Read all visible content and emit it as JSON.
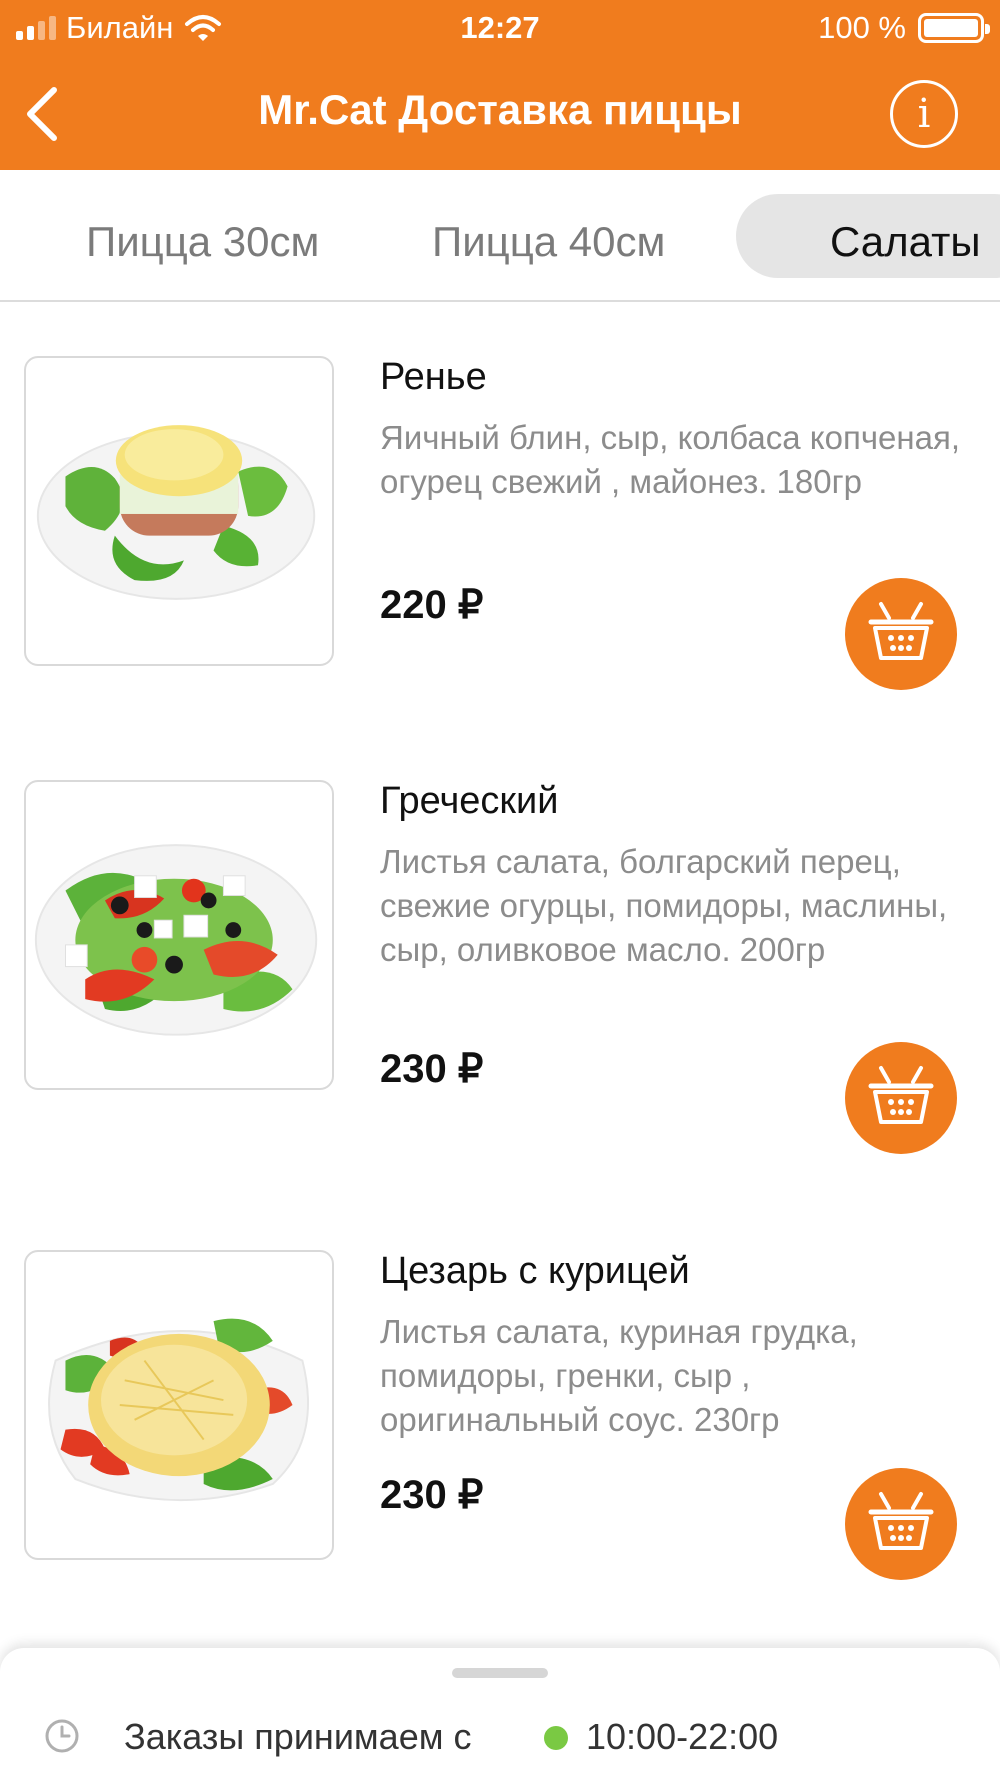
{
  "status_bar": {
    "carrier": "Билайн",
    "time": "12:27",
    "battery": "100 %"
  },
  "header": {
    "title": "Mr.Cat Доставка пиццы",
    "info_label": "i",
    "accent_color": "#f07c1e"
  },
  "tabs": [
    {
      "label": "Пицца 30см",
      "active": false
    },
    {
      "label": "Пицца 40см",
      "active": false
    },
    {
      "label": "Салаты",
      "active": true
    }
  ],
  "products": [
    {
      "name": "Ренье",
      "description": "Яичный блин, сыр, колбаса копченая, огурец свежий , майонез. 180гр",
      "price": "220 ₽",
      "icon": "basket-icon"
    },
    {
      "name": "Греческий",
      "description": "Листья салата, болгарский перец, свежие огурцы, помидоры, маслины, сыр, оливковое масло. 200гр",
      "price": "230 ₽",
      "icon": "basket-icon"
    },
    {
      "name": "Цезарь с курицей",
      "description": "Листья салата, куриная грудка, помидоры, гренки, сыр , оригинальный соус. 230гр",
      "price": "230 ₽",
      "icon": "basket-icon"
    }
  ],
  "footer": {
    "orders_label": "Заказы принимаем с",
    "hours": "10:00-22:00",
    "open_color": "#7ac943"
  }
}
